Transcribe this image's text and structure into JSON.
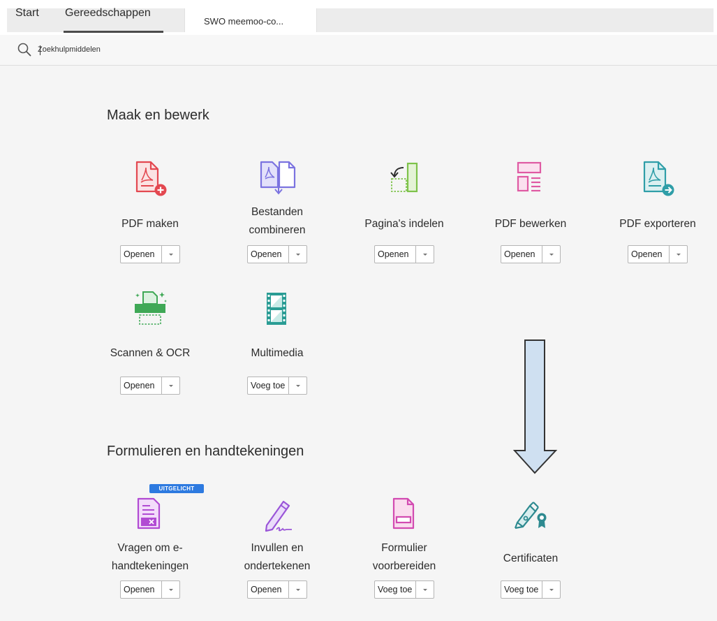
{
  "tabs": {
    "start": "Start",
    "tools": "Gereedschappen",
    "document": "SWO meemoo-co..."
  },
  "search": {
    "placeholder": "Zoekhulpmiddelen"
  },
  "sections": {
    "create_edit": "Maak en bewerk",
    "forms_signatures": "Formulieren en handtekeningen"
  },
  "tools": {
    "pdf_make": {
      "label": "PDF maken",
      "button": "Openen",
      "icon": "pdf-create-icon",
      "color": "#e34850"
    },
    "combine": {
      "label_line1": "Bestanden",
      "label_line2": "combineren",
      "button": "Openen",
      "icon": "combine-files-icon",
      "color": "#7b73e0"
    },
    "organize": {
      "label": "Pagina's indelen",
      "button": "Openen",
      "icon": "organize-pages-icon",
      "color": "#7dc24a"
    },
    "edit": {
      "label": "PDF bewerken",
      "button": "Openen",
      "icon": "pdf-edit-icon",
      "color": "#df5aa3"
    },
    "export": {
      "label": "PDF exporteren",
      "button": "Openen",
      "icon": "pdf-export-icon",
      "color": "#2f9ea8"
    },
    "scan": {
      "label": "Scannen & OCR",
      "button": "Openen",
      "icon": "scanner-icon",
      "color": "#3fa856"
    },
    "multimedia": {
      "label": "Multimedia",
      "button": "Voeg toe",
      "icon": "film-icon",
      "color": "#2a9c94"
    },
    "esign": {
      "label_line1": "Vragen om e-",
      "label_line2": "handtekeningen",
      "button": "Openen",
      "icon": "request-signature-icon",
      "color": "#b14bd3",
      "badge": "UITGELICHT"
    },
    "fill_sign": {
      "label_line1": "Invullen en",
      "label_line2": "ondertekenen",
      "button": "Openen",
      "icon": "fill-sign-pen-icon",
      "color": "#9a55d8"
    },
    "prepare_form": {
      "label_line1": "Formulier",
      "label_line2": "voorbereiden",
      "button": "Voeg toe",
      "icon": "prepare-form-icon",
      "color": "#d24ab1"
    },
    "certificates": {
      "label": "Certificaten",
      "button": "Voeg toe",
      "icon": "certificate-pen-icon",
      "color": "#2e8a90"
    }
  },
  "annotation_arrow": {
    "fill": "#cfe0f1",
    "stroke": "#333333"
  }
}
